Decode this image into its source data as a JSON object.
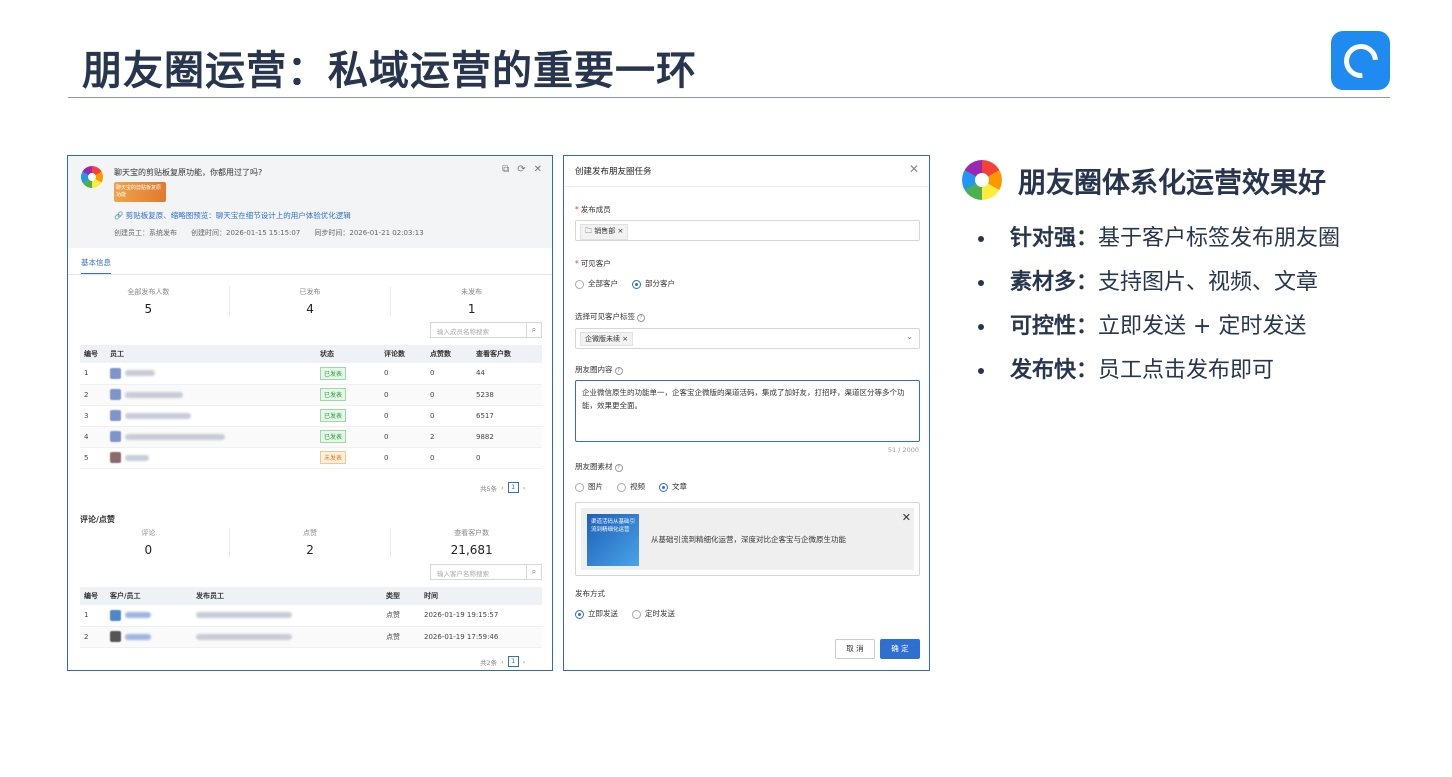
{
  "slide": {
    "title": "朋友圈运营：私域运营的重要一环"
  },
  "left_panel": {
    "question": "聊天宝的剪贴板复原功能，你都用过了吗?",
    "thumb_text": "聊天宝的剪贴板复原功能",
    "link_text": "剪贴板复原、缩略图预览：聊天宝在细节设计上的用户体验优化逻辑",
    "meta": {
      "creator": "创建员工：系统发布",
      "created": "创建时间：2026-01-15 15:15:07",
      "synced": "同步时间：2026-01-21 02:03:13"
    },
    "tab": "基本信息",
    "stats": [
      {
        "label": "全部发布人数",
        "value": "5"
      },
      {
        "label": "已发布",
        "value": "4"
      },
      {
        "label": "未发布",
        "value": "1"
      }
    ],
    "search_placeholder": "输入成员名称搜索",
    "table": {
      "headers": [
        "编号",
        "员工",
        "状态",
        "评论数",
        "点赞数",
        "查看客户数"
      ],
      "rows": [
        {
          "no": "1",
          "status": "已发表",
          "comments": "0",
          "likes": "0",
          "viewers": "44"
        },
        {
          "no": "2",
          "status": "已发表",
          "comments": "0",
          "likes": "0",
          "viewers": "5238"
        },
        {
          "no": "3",
          "status": "已发表",
          "comments": "0",
          "likes": "0",
          "viewers": "6517"
        },
        {
          "no": "4",
          "status": "已发表",
          "comments": "0",
          "likes": "2",
          "viewers": "9882"
        },
        {
          "no": "5",
          "status": "未发表",
          "comments": "0",
          "likes": "0",
          "viewers": "0"
        }
      ]
    },
    "pager1": {
      "total": "共5条",
      "page": "1"
    },
    "section2_title": "评论/点赞",
    "stats2": [
      {
        "label": "评论",
        "value": "0"
      },
      {
        "label": "点赞",
        "value": "2"
      },
      {
        "label": "查看客户数",
        "value": "21,681"
      }
    ],
    "search2_placeholder": "输入客户名称搜索",
    "table2": {
      "headers": [
        "编号",
        "客户/员工",
        "发布员工",
        "类型",
        "时间"
      ],
      "rows": [
        {
          "no": "1",
          "type": "点赞",
          "time": "2026-01-19 19:15:57"
        },
        {
          "no": "2",
          "type": "点赞",
          "time": "2026-01-19 17:59:46"
        }
      ]
    },
    "pager2": {
      "total": "共2条",
      "page": "1"
    }
  },
  "mid_panel": {
    "title": "创建发布朋友圈任务",
    "publisher_label": "发布成员",
    "publisher_chip": "销售部",
    "visible_label": "可见客户",
    "visible_options": [
      "全部客户",
      "部分客户"
    ],
    "tag_label": "选择可见客户标签",
    "tag_chip": "企微版未续",
    "content_label": "朋友圈内容",
    "content_text": "企业微信原生的功能单一，企客宝企微版的渠道活码，集成了加好友，打招呼，渠道区分等多个功能，效果更全面。",
    "counter": "51 / 2000",
    "material_label": "朋友圈素材",
    "material_options": [
      "图片",
      "视频",
      "文章"
    ],
    "material_title": "从基础引流到精细化运营，深度对比企客宝与企微原生功能",
    "material_img_text": "渠道活码从基础引流到精细化运营",
    "send_label": "发布方式",
    "send_options": [
      "立即发送",
      "定时发送"
    ],
    "cancel_label": "取 消",
    "ok_label": "确 定"
  },
  "right": {
    "title": "朋友圈体系化运营效果好",
    "bullets": [
      {
        "kw": "针对强：",
        "text": "基于客户标签发布朋友圈"
      },
      {
        "kw": "素材多：",
        "text": "支持图片、视频、文章"
      },
      {
        "kw": "可控性：",
        "text": "立即发送 + 定时发送"
      },
      {
        "kw": "发布快：",
        "text": "员工点击发布即可"
      }
    ]
  },
  "colors": {
    "title": "#27354f",
    "accent": "#2f6fd1",
    "logo": "#1f8bf0"
  }
}
